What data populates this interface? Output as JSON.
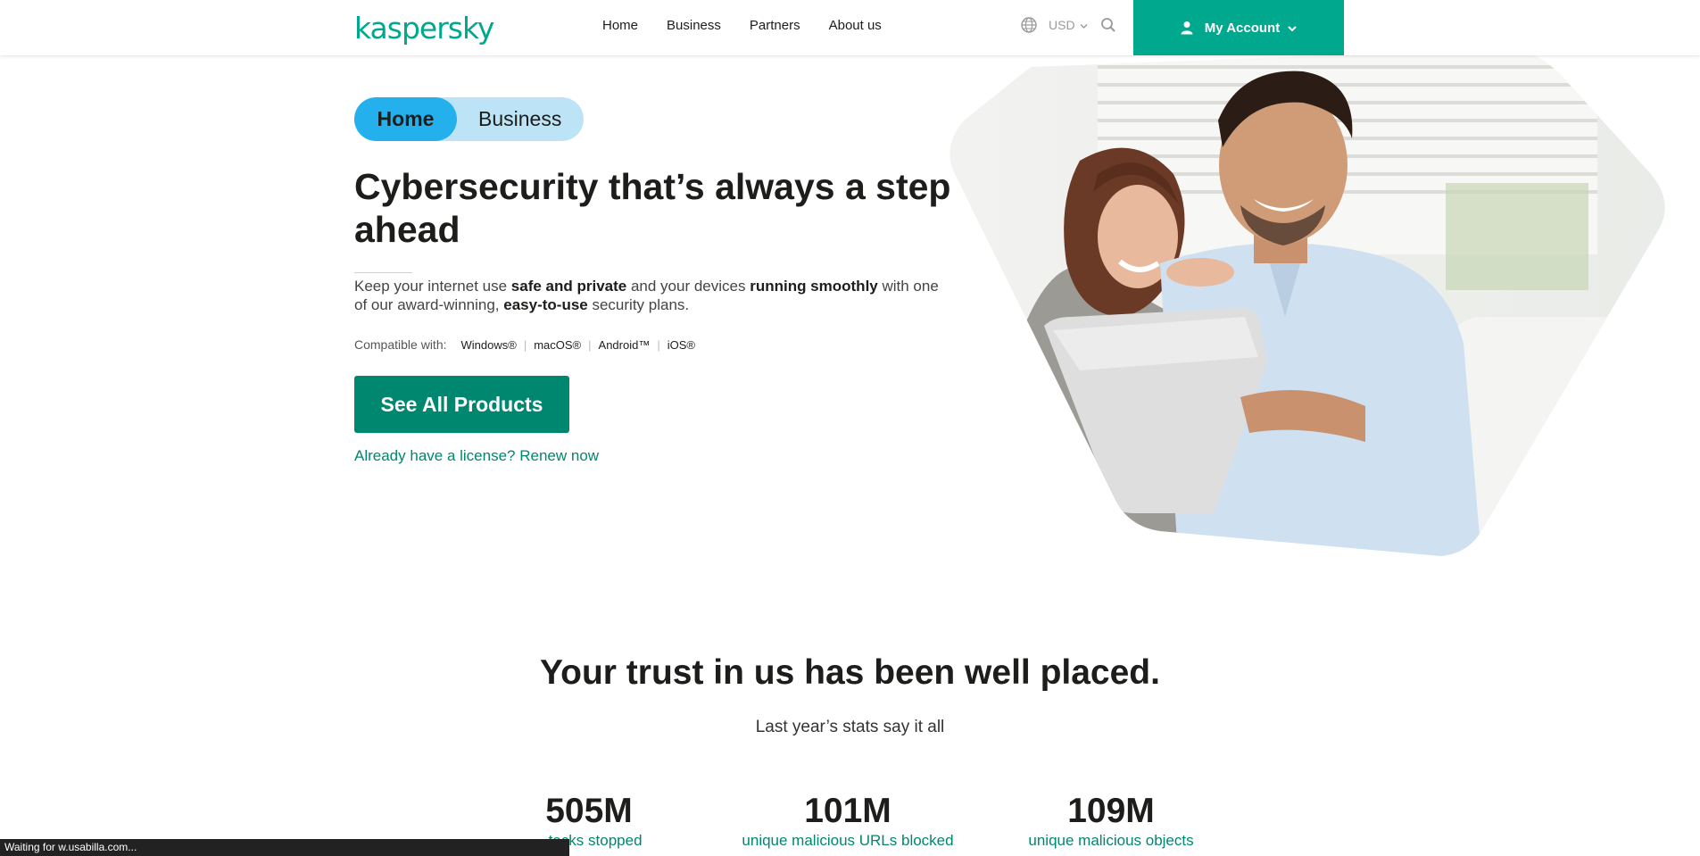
{
  "header": {
    "logo": "kaspersky",
    "nav": [
      "Home",
      "Business",
      "Partners",
      "About us"
    ],
    "currency": "USD",
    "account_label": "My Account"
  },
  "hero": {
    "toggle": {
      "active": "Home",
      "inactive": "Business"
    },
    "title": "Cybersecurity that’s always a step ahead",
    "desc": {
      "t1": "Keep your internet use ",
      "b1": "safe and private",
      "t2": " and your devices ",
      "b2": "running smoothly",
      "t3": " with one of our award-winning, ",
      "b3": "easy-to-use",
      "t4": " security plans."
    },
    "compat_label": "Compatible with:",
    "platforms": [
      "Windows®",
      "macOS®",
      "Android™",
      "iOS®"
    ],
    "cta": "See All Products",
    "renew": "Already have a license? Renew now"
  },
  "trust": {
    "title": "Your trust in us has been well placed.",
    "subtitle": "Last year’s stats say it all",
    "stats": [
      {
        "num": "505M",
        "label": "...tacks stopped"
      },
      {
        "num": "101M",
        "label": "unique malicious URLs blocked"
      },
      {
        "num": "109M",
        "label": "unique malicious objects"
      }
    ]
  },
  "status_bar": "Waiting for w.usabilla.com...",
  "colors": {
    "brand": "#00a88e",
    "cta": "#00876f",
    "toggle_active": "#23b0ed",
    "toggle_bg": "#bde3f6"
  }
}
